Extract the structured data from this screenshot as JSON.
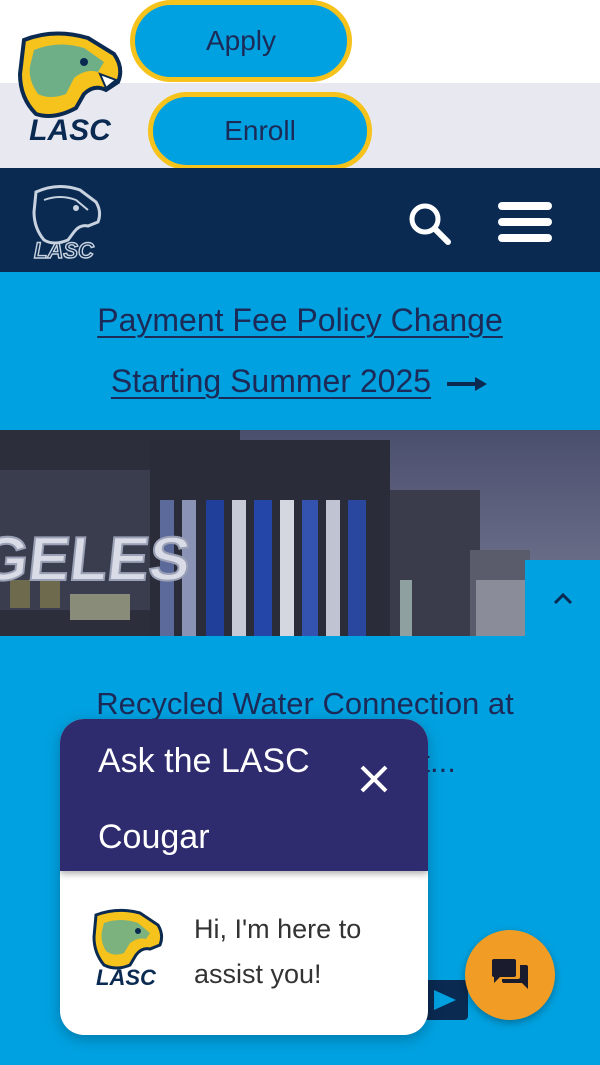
{
  "header": {
    "apply_label": "Apply",
    "enroll_label": "Enroll"
  },
  "nav": {
    "search_icon": "search-icon",
    "menu_icon": "hamburger-menu-icon"
  },
  "announcement": {
    "line1": "Payment Fee Policy Change",
    "line2": "Starting Summer 2025"
  },
  "hero": {
    "sign_text": "GELES"
  },
  "news": {
    "title_line1": "Recycled Water Connection at",
    "title_line2": "nt..."
  },
  "chat": {
    "title_line1": "Ask the LASC",
    "title_line2": "Cougar",
    "message_line1": "Hi, I'm here to",
    "message_line2": "assist you!"
  },
  "colors": {
    "brand_blue": "#00a1e0",
    "navy": "#0a2a52",
    "gold": "#f6c21c",
    "chat_purple": "#2e2b6e",
    "fab_orange": "#f19d25"
  }
}
